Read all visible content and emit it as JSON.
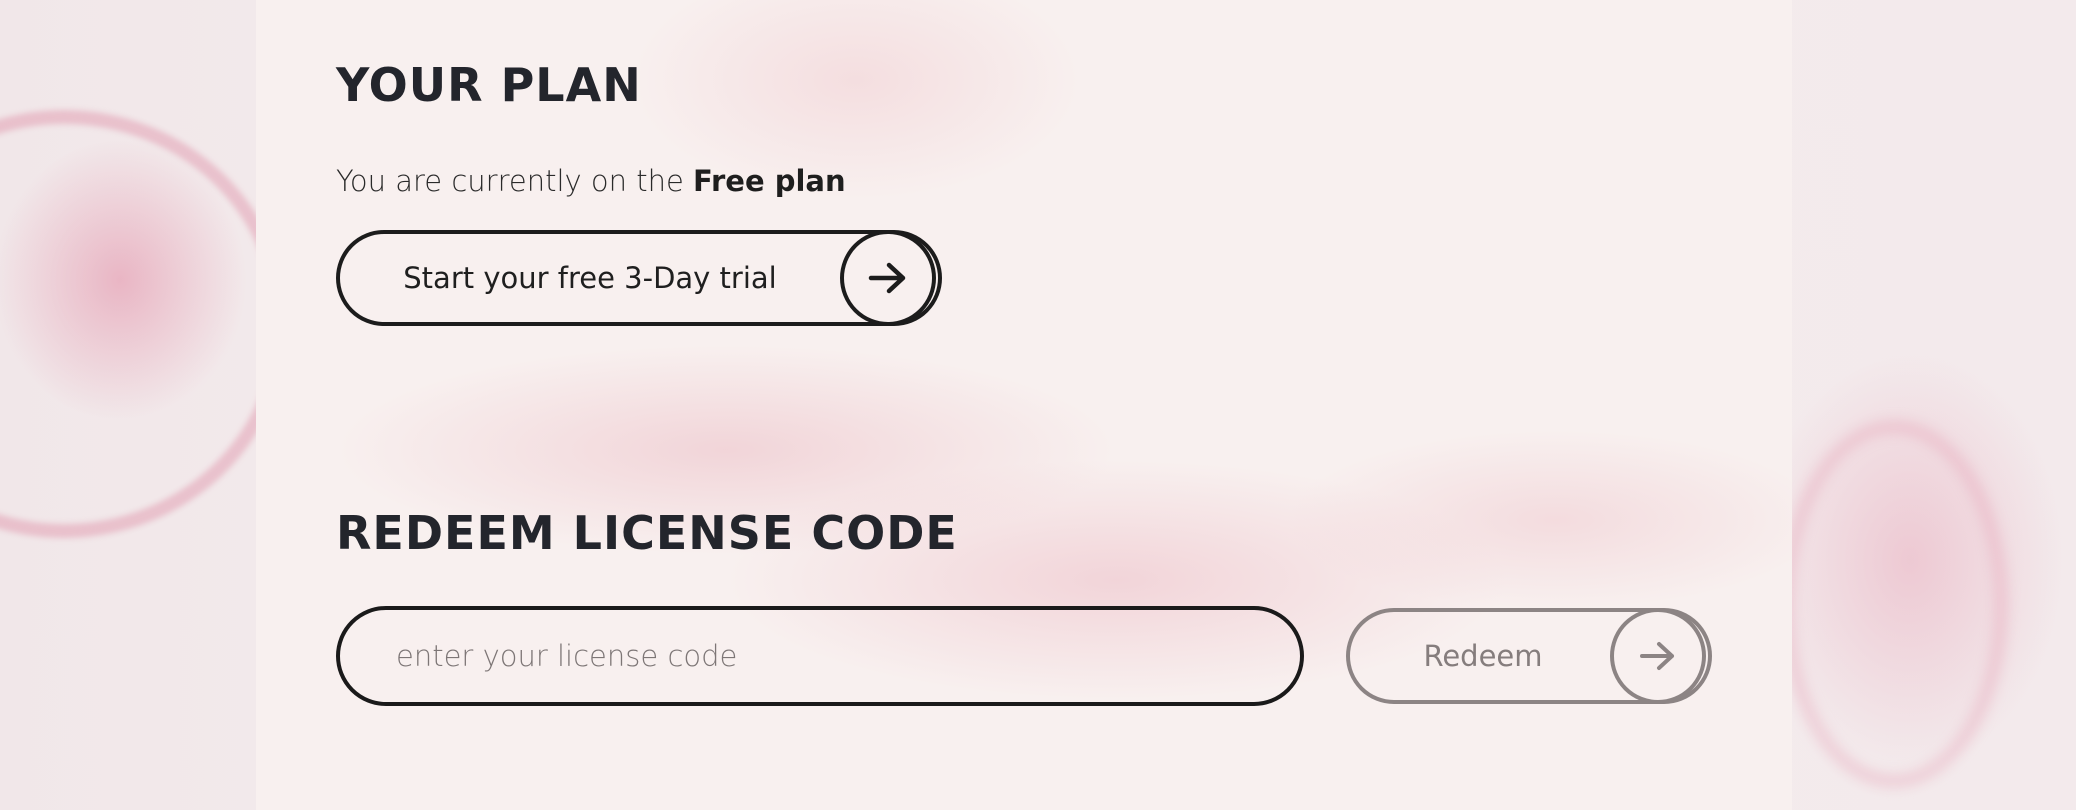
{
  "plan": {
    "title": "YOUR PLAN",
    "status_prefix": "You are currently on the ",
    "status_plan": "Free plan",
    "trial_button_label": "Start your free 3-Day trial",
    "trial_button_icon": "arrow-right-icon"
  },
  "license": {
    "title": "REDEEM LICENSE CODE",
    "input_value": "",
    "input_placeholder": "enter your license code",
    "redeem_button_label": "Redeem",
    "redeem_button_icon": "arrow-right-icon"
  },
  "colors": {
    "heading": "#23252c",
    "border_active": "#1c1c1c",
    "border_disabled": "#8c8484",
    "panel_bg": "#f8f0ef"
  }
}
